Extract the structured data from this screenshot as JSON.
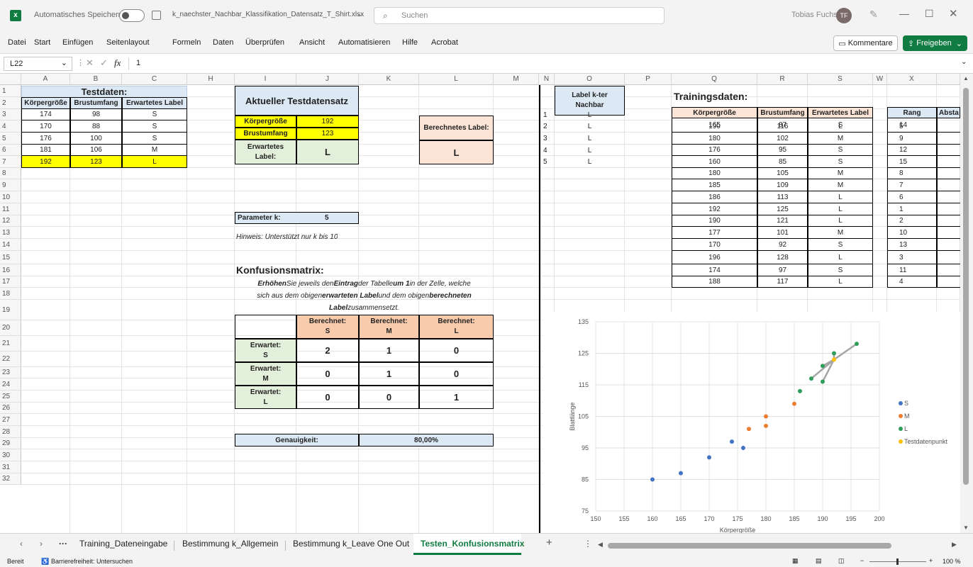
{
  "titlebar": {
    "autosave_label": "Automatisches Speichern",
    "filename": "k_naechster_Nachbar_Klassifikation_Datensatz_T_Shirt.xlsx",
    "search_placeholder": "Suchen",
    "user_name": "Tobias Fuchs",
    "user_initials": "TF"
  },
  "menu": {
    "items": [
      "Datei",
      "Start",
      "Einfügen",
      "Seitenlayout",
      "Formeln",
      "Daten",
      "Überprüfen",
      "Ansicht",
      "Automatisieren",
      "Hilfe",
      "Acrobat"
    ],
    "comments_label": "Kommentare",
    "share_label": "Freigeben"
  },
  "formula": {
    "cell_ref": "L22",
    "value": "1"
  },
  "columns": [
    "A",
    "B",
    "C",
    "H",
    "I",
    "J",
    "K",
    "L",
    "M",
    "N",
    "O",
    "P",
    "Q",
    "R",
    "S",
    "W",
    "X"
  ],
  "rows": [
    "1",
    "2",
    "3",
    "4",
    "5",
    "6",
    "7",
    "8",
    "9",
    "10",
    "11",
    "12",
    "13",
    "14",
    "15",
    "16",
    "17",
    "18",
    "19",
    "20",
    "21",
    "22",
    "23",
    "24",
    "25",
    "26",
    "27",
    "28",
    "29",
    "30",
    "31",
    "32"
  ],
  "testdaten": {
    "title": "Testdaten:",
    "headers": [
      "Körpergröße",
      "Brustumfang",
      "Erwartetes Label"
    ],
    "rows": [
      [
        "174",
        "98",
        "S"
      ],
      [
        "170",
        "88",
        "S"
      ],
      [
        "176",
        "100",
        "S"
      ],
      [
        "181",
        "106",
        "M"
      ],
      [
        "192",
        "123",
        "L"
      ]
    ]
  },
  "aktuell": {
    "title": "Aktueller Testdatensatz",
    "koerper_label": "Körpergröße",
    "koerper_value": "192",
    "brust_label": "Brustumfang",
    "brust_value": "123",
    "erwartet_label1": "Erwartetes",
    "erwartet_label2": "Label:",
    "erwartet_value": "L"
  },
  "berechnet": {
    "label": "Berechnetes Label:",
    "value": "L"
  },
  "parameter": {
    "label": "Parameter k:",
    "value": "5",
    "hint": "Hinweis:  Unterstützt nur k bis 10"
  },
  "konfusion": {
    "title": "Konfusionsmatrix:",
    "instr1_a": "Erhöhen",
    "instr1_b": " Sie jeweils den ",
    "instr1_c": "Eintrag",
    "instr1_d": " der Tabelle ",
    "instr1_e": "um 1",
    "instr1_f": " in der Zelle, welche",
    "instr2_a": "sich aus dem obigen ",
    "instr2_b": "erwarteten Label",
    "instr2_c": " und dem obigen ",
    "instr2_d": "berechneten",
    "instr3_a": "Label",
    "instr3_b": " zusammensetzt.",
    "col_headers": [
      [
        "Berechnet:",
        "S"
      ],
      [
        "Berechnet:",
        "M"
      ],
      [
        "Berechnet:",
        "L"
      ]
    ],
    "row_headers": [
      [
        "Erwartet:",
        "S"
      ],
      [
        "Erwartet:",
        "M"
      ],
      [
        "Erwartet:",
        "L"
      ]
    ],
    "values": [
      [
        "2",
        "1",
        "0"
      ],
      [
        "0",
        "1",
        "0"
      ],
      [
        "0",
        "0",
        "1"
      ]
    ]
  },
  "genauigkeit": {
    "label": "Genauigkeit:",
    "value": "80,00%"
  },
  "nachbarn": {
    "header1": "Label k-ter",
    "header2": "Nachbar",
    "rows": [
      [
        "1",
        "L"
      ],
      [
        "2",
        "L"
      ],
      [
        "3",
        "L"
      ],
      [
        "4",
        "L"
      ],
      [
        "5",
        "L"
      ]
    ]
  },
  "training": {
    "title": "Trainingsdaten:",
    "headers": [
      "Körpergröße",
      "Brustumfang",
      "Erwartetes Label"
    ],
    "rank_header": "Rang",
    "abst_header": "Absta",
    "rows": [
      [
        "165",
        "87",
        "S",
        "14"
      ],
      [
        "190",
        "116",
        "L",
        "5"
      ],
      [
        "180",
        "102",
        "M",
        "9"
      ],
      [
        "176",
        "95",
        "S",
        "12"
      ],
      [
        "160",
        "85",
        "S",
        "15"
      ],
      [
        "180",
        "105",
        "M",
        "8"
      ],
      [
        "185",
        "109",
        "M",
        "7"
      ],
      [
        "186",
        "113",
        "L",
        "6"
      ],
      [
        "192",
        "125",
        "L",
        "1"
      ],
      [
        "190",
        "121",
        "L",
        "2"
      ],
      [
        "177",
        "101",
        "M",
        "10"
      ],
      [
        "170",
        "92",
        "S",
        "13"
      ],
      [
        "196",
        "128",
        "L",
        "3"
      ],
      [
        "174",
        "97",
        "S",
        "11"
      ],
      [
        "188",
        "117",
        "L",
        "4"
      ]
    ]
  },
  "chart_data": {
    "type": "scatter",
    "xlabel": "Körpergröße",
    "ylabel": "Blattlänge",
    "xlim": [
      150,
      200
    ],
    "ylim": [
      75,
      135
    ],
    "xticks": [
      "150",
      "155",
      "160",
      "165",
      "170",
      "175",
      "180",
      "185",
      "190",
      "195",
      "200"
    ],
    "yticks": [
      "75",
      "85",
      "95",
      "105",
      "115",
      "125",
      "135"
    ],
    "legend_position": "right",
    "series": [
      {
        "name": "S",
        "color": "#4472c4",
        "points": [
          [
            165,
            87
          ],
          [
            176,
            95
          ],
          [
            160,
            85
          ],
          [
            170,
            92
          ],
          [
            174,
            97
          ]
        ]
      },
      {
        "name": "M",
        "color": "#ed7d31",
        "points": [
          [
            180,
            102
          ],
          [
            180,
            105
          ],
          [
            185,
            109
          ],
          [
            177,
            101
          ]
        ]
      },
      {
        "name": "L",
        "color": "#2e9e5b",
        "points": [
          [
            190,
            116
          ],
          [
            186,
            113
          ],
          [
            192,
            125
          ],
          [
            190,
            121
          ],
          [
            196,
            128
          ],
          [
            188,
            117
          ]
        ]
      },
      {
        "name": "Testdatenpunkt",
        "color": "#ffc000",
        "points": [
          [
            192,
            123
          ]
        ]
      }
    ],
    "neighbor_lines": [
      [
        192,
        123,
        192,
        125
      ],
      [
        192,
        123,
        190,
        121
      ],
      [
        192,
        123,
        196,
        128
      ],
      [
        192,
        123,
        188,
        117
      ],
      [
        192,
        123,
        190,
        116
      ]
    ]
  },
  "sheets": {
    "tabs": [
      "Training_Dateneingabe",
      "Bestimmung k_Allgemein",
      "Bestimmung k_Leave One Out",
      "Testen_Konfusionsmatrix"
    ],
    "active": "Testen_Konfusionsmatrix"
  },
  "status": {
    "ready": "Bereit",
    "accessibility": "Barrierefreiheit: Untersuchen",
    "zoom": "100 %"
  }
}
